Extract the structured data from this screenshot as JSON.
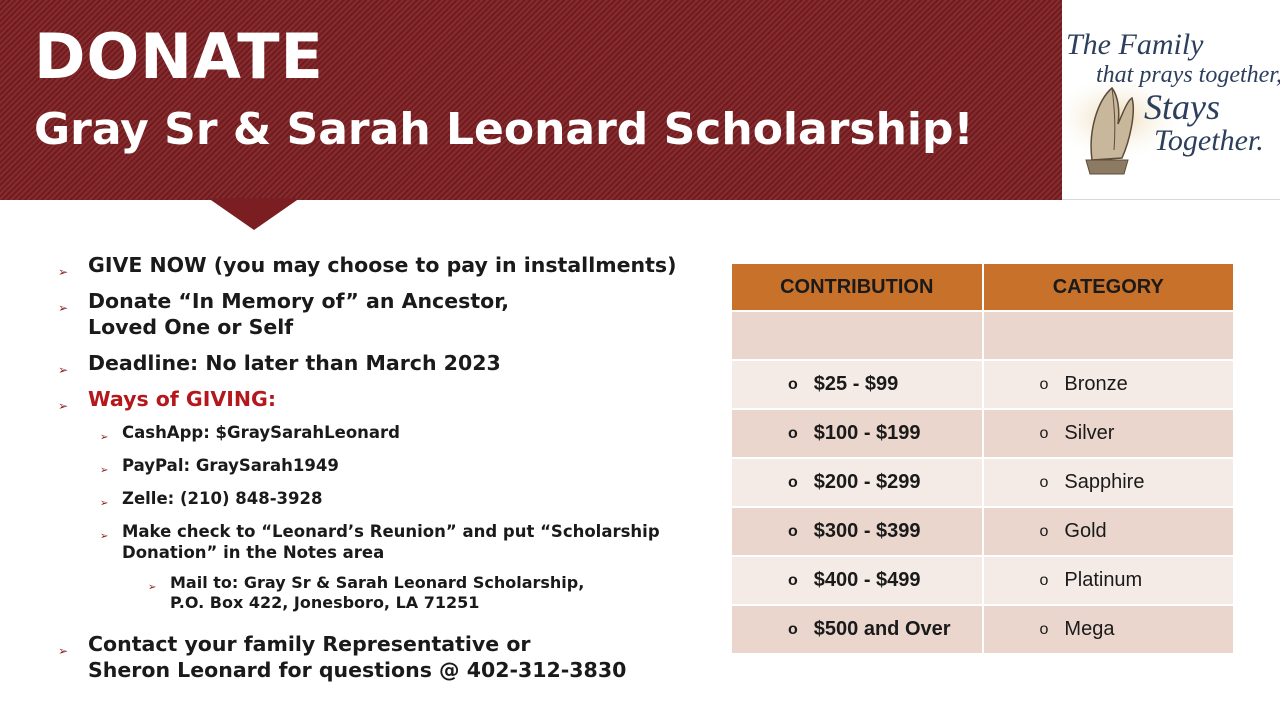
{
  "banner": {
    "title": "DONATE",
    "subtitle": "Gray Sr & Sarah Leonard Scholarship!",
    "color": "#7d1f22"
  },
  "logo": {
    "line1": "The Family",
    "line2": "that prays together,",
    "line3": "Stays",
    "line4": "Together.",
    "icon": "praying-hands-icon"
  },
  "bullets": {
    "give_now": "GIVE NOW (you may choose to pay in installments)",
    "in_memory_line1": "Donate “In Memory of” an Ancestor,",
    "in_memory_line2": "Loved One or Self",
    "deadline": "Deadline:  No later than March 2023",
    "ways": "Ways of GIVING:",
    "cashapp": "CashApp:  $GraySarahLeonard",
    "paypal": "PayPal:  GraySarah1949",
    "zelle": "Zelle: (210) 848-3928",
    "check_line1": "Make check to “Leonard’s Reunion” and put “Scholarship",
    "check_line2": "Donation” in the Notes area",
    "mail_line1": "Mail to: Gray Sr & Sarah Leonard Scholarship,",
    "mail_line2": "P.O. Box 422, Jonesboro, LA  71251",
    "contact_line1": "Contact your family Representative  or",
    "contact_line2": "Sheron Leonard for questions @  402-312-3830"
  },
  "table": {
    "headers": [
      "CONTRIBUTION",
      "CATEGORY"
    ],
    "header_color": "#c8712a",
    "bullet": "o",
    "rows": [
      {
        "contribution": "",
        "category": ""
      },
      {
        "contribution": "$25 - $99",
        "category": "Bronze"
      },
      {
        "contribution": "$100 - $199",
        "category": "Silver"
      },
      {
        "contribution": "$200 - $299",
        "category": "Sapphire"
      },
      {
        "contribution": "$300 - $399",
        "category": "Gold"
      },
      {
        "contribution": "$400 - $499",
        "category": "Platinum"
      },
      {
        "contribution": "$500 and Over",
        "category": "Mega"
      }
    ]
  }
}
